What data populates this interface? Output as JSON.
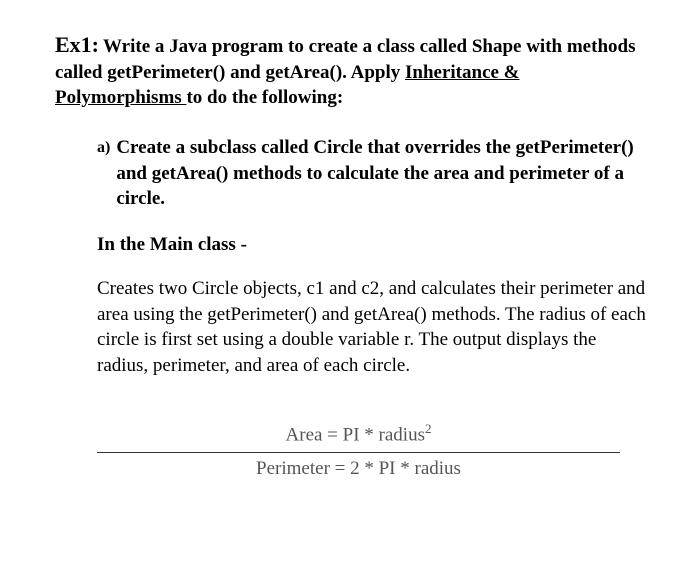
{
  "title": {
    "ex_label": "Ex1:",
    "line": "Write a Java program to create a class called Shape with methods called getPerimeter() and getArea(). Apply ",
    "underlined": "Inheritance & Polymorphisms ",
    "tail": "to do the following:"
  },
  "item_a": {
    "marker": "a)",
    "text": "Create a subclass called Circle that overrides the getPerimeter() and getArea() methods to calculate the area and perimeter of a circle."
  },
  "subhead": "In the Main class -",
  "paragraph": "Creates two Circle objects, c1 and c2, and calculates their perimeter and area using the getPerimeter() and getArea() methods. The radius of each circle is first set using a double variable r. The output displays the radius, perimeter, and area of each circle.",
  "formulas": {
    "area_prefix": "Area = PI * radius",
    "area_exp": "2",
    "perimeter": "Perimeter = 2 * PI * radius"
  }
}
